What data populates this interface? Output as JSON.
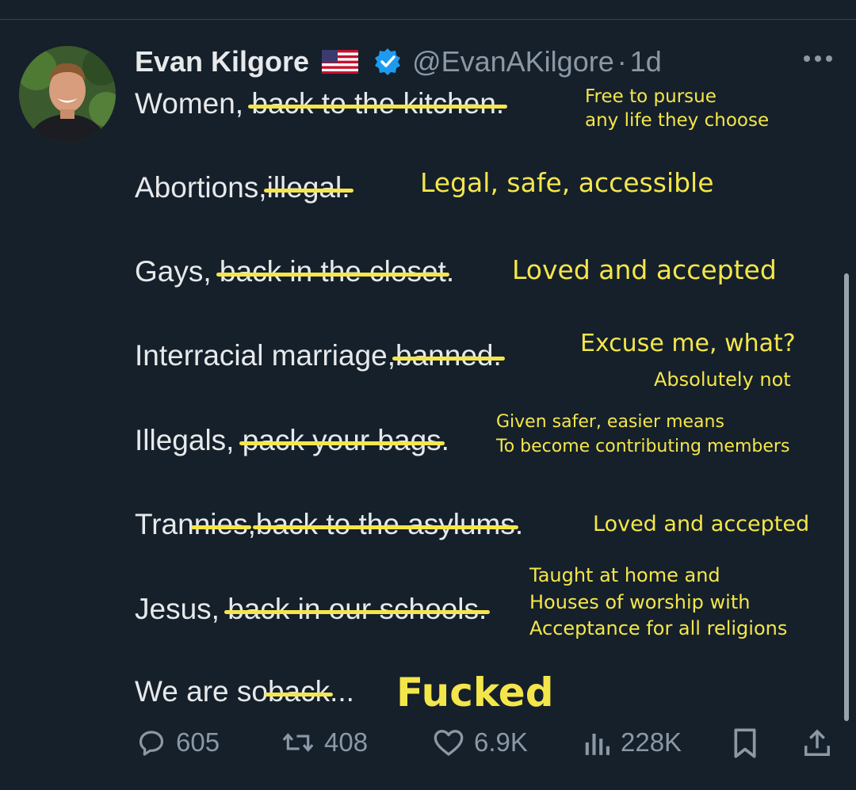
{
  "tweet": {
    "display_name": "Evan Kilgore",
    "handle": "@EvanAKilgore",
    "separator": "·",
    "age": "1d",
    "lines": [
      {
        "prefix": "Women,",
        "struck": "back to the kitchen.",
        "suffix": ""
      },
      {
        "prefix": "Abortions,",
        "struck": "illegal.",
        "suffix": ""
      },
      {
        "prefix": "Gays,",
        "struck": "back in the closet",
        "suffix": "."
      },
      {
        "prefix": "Interracial marriage,",
        "struck": "banned.",
        "suffix": ""
      },
      {
        "prefix": "Illegals,",
        "struck": "pack your bags",
        "suffix": "."
      },
      {
        "prefix": "Tran",
        "struck_mid": "nies",
        "prefix2": ",",
        "struck": "back to the asylums",
        "suffix": "."
      },
      {
        "prefix": "Jesus,",
        "struck": "back in our schools.",
        "suffix": ""
      },
      {
        "prefix": "We are so",
        "struck": "back",
        "suffix": "..."
      }
    ]
  },
  "annotations": {
    "women": [
      "Free to pursue",
      "any life they choose"
    ],
    "abortions": "Legal, safe, accessible",
    "gays": "Loved and accepted",
    "interracial_1": "Excuse me, what?",
    "interracial_2": "Absolutely not",
    "illegals": [
      "Given safer, easier means",
      "To become contributing members"
    ],
    "trannies": "Loved and accepted",
    "jesus": [
      "Taught at home and",
      "Houses of worship with",
      "Acceptance for all religions"
    ],
    "final": "Fucked"
  },
  "actions": {
    "replies": "605",
    "retweets": "408",
    "likes": "6.9K",
    "views": "228K"
  },
  "icons": {
    "reply": "reply-icon",
    "retweet": "retweet-icon",
    "like": "heart-icon",
    "views": "views-icon",
    "bookmark": "bookmark-icon",
    "share": "share-icon",
    "verified": "verified-badge-icon",
    "flag": "us-flag-icon",
    "more": "more-icon"
  },
  "colors": {
    "background": "#15202b",
    "annotation": "#f4e64a",
    "verified": "#1d9bf0",
    "muted": "#8b98a5"
  }
}
